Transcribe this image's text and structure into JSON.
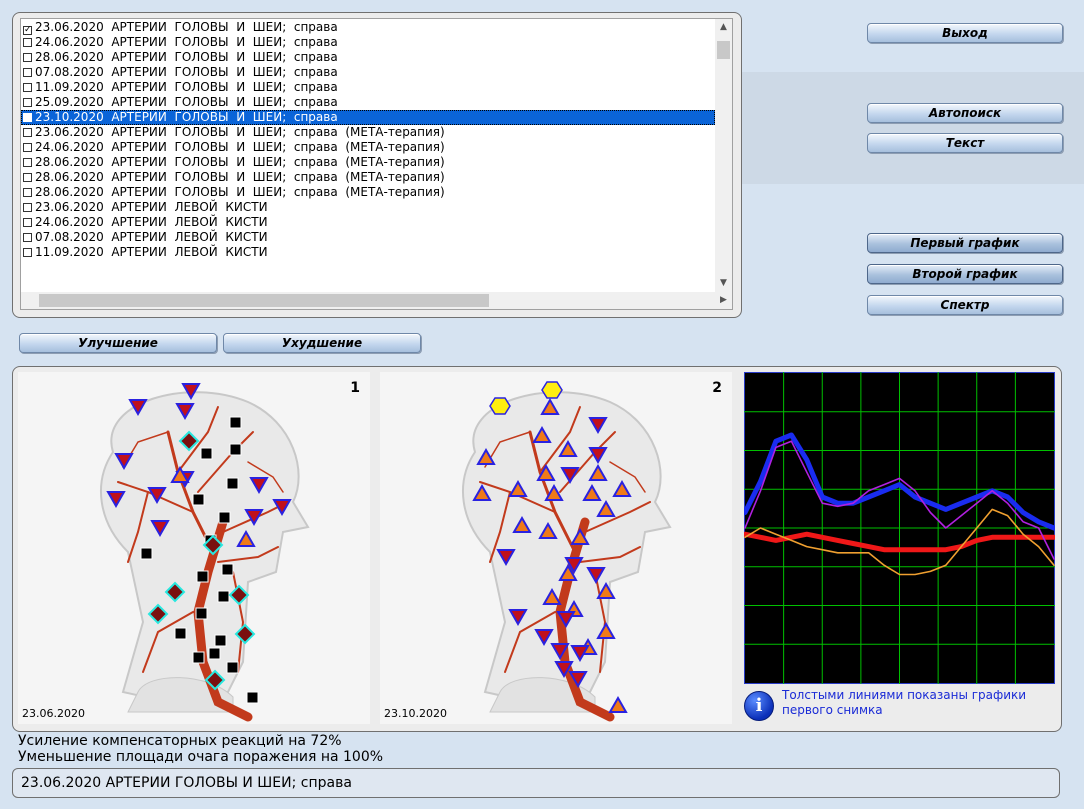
{
  "records": [
    {
      "text": "23.06.2020  АРТЕРИИ  ГОЛОВЫ  И  ШЕИ;  справа",
      "checked": true,
      "selected": false
    },
    {
      "text": "24.06.2020  АРТЕРИИ  ГОЛОВЫ  И  ШЕИ;  справа",
      "checked": false,
      "selected": false
    },
    {
      "text": "28.06.2020  АРТЕРИИ  ГОЛОВЫ  И  ШЕИ;  справа",
      "checked": false,
      "selected": false
    },
    {
      "text": "07.08.2020  АРТЕРИИ  ГОЛОВЫ  И  ШЕИ;  справа",
      "checked": false,
      "selected": false
    },
    {
      "text": "11.09.2020  АРТЕРИИ  ГОЛОВЫ  И  ШЕИ;  справа",
      "checked": false,
      "selected": false
    },
    {
      "text": "25.09.2020  АРТЕРИИ  ГОЛОВЫ  И  ШЕИ;  справа",
      "checked": false,
      "selected": false
    },
    {
      "text": "23.10.2020  АРТЕРИИ  ГОЛОВЫ  И  ШЕИ;  справа",
      "checked": false,
      "selected": true
    },
    {
      "text": "23.06.2020  АРТЕРИИ  ГОЛОВЫ  И  ШЕИ;  справа  (МЕТА-терапия)",
      "checked": false,
      "selected": false
    },
    {
      "text": "24.06.2020  АРТЕРИИ  ГОЛОВЫ  И  ШЕИ;  справа  (МЕТА-терапия)",
      "checked": false,
      "selected": false
    },
    {
      "text": "28.06.2020  АРТЕРИИ  ГОЛОВЫ  И  ШЕИ;  справа  (МЕТА-терапия)",
      "checked": false,
      "selected": false
    },
    {
      "text": "28.06.2020  АРТЕРИИ  ГОЛОВЫ  И  ШЕИ;  справа  (МЕТА-терапия)",
      "checked": false,
      "selected": false
    },
    {
      "text": "28.06.2020  АРТЕРИИ  ГОЛОВЫ  И  ШЕИ;  справа  (МЕТА-терапия)",
      "checked": false,
      "selected": false
    },
    {
      "text": "23.06.2020  АРТЕРИИ  ЛЕВОЙ  КИСТИ",
      "checked": false,
      "selected": false
    },
    {
      "text": "24.06.2020  АРТЕРИИ  ЛЕВОЙ  КИСТИ",
      "checked": false,
      "selected": false
    },
    {
      "text": "07.08.2020  АРТЕРИИ  ЛЕВОЙ  КИСТИ",
      "checked": false,
      "selected": false
    },
    {
      "text": "11.09.2020  АРТЕРИИ  ЛЕВОЙ  КИСТИ",
      "checked": false,
      "selected": false
    }
  ],
  "buttons": {
    "exit": "Выход",
    "autosearch": "Автопоиск",
    "text": "Текст",
    "first_graph": "Первый график",
    "second_graph": "Второй график",
    "spectrum": "Спектр",
    "improvement": "Улучшение",
    "deterioration": "Ухудшение"
  },
  "images": [
    {
      "number": "1",
      "date": "23.06.2020"
    },
    {
      "number": "2",
      "date": "23.10.2020"
    }
  ],
  "info_text": "Толстыми линиями показаны графики первого снимка",
  "stats": [
    "Усиление компенсаторных реакций на 72%",
    "Уменьшение площади очага поражения на 100%"
  ],
  "selected_record": "23.06.2020 АРТЕРИИ  ГОЛОВЫ  И  ШЕИ;  справа",
  "colors": {
    "thick_blue": "#1a2cf0",
    "thick_red": "#f01818",
    "thin_violet": "#b020e0",
    "thin_orange": "#f0a030",
    "grid": "#00c000",
    "chart_bg": "#000000"
  },
  "chart_data": {
    "type": "line",
    "x": [
      0,
      1,
      2,
      3,
      4,
      5,
      6,
      7,
      8,
      9,
      10,
      11,
      12,
      13,
      14,
      15,
      16,
      17,
      18,
      19,
      20
    ],
    "series": [
      {
        "style": "thick",
        "color": "#1a2cf0",
        "values": [
          55,
          65,
          78,
          80,
          72,
          60,
          58,
          58,
          60,
          62,
          64,
          60,
          58,
          56,
          58,
          60,
          62,
          60,
          55,
          52,
          50
        ]
      },
      {
        "style": "thick",
        "color": "#f01818",
        "values": [
          48,
          47,
          46,
          47,
          48,
          47,
          46,
          45,
          44,
          43,
          43,
          43,
          43,
          43,
          44,
          46,
          47,
          47,
          47,
          47,
          47
        ]
      },
      {
        "style": "thin",
        "color": "#b020e0",
        "values": [
          50,
          62,
          76,
          78,
          68,
          58,
          57,
          58,
          62,
          64,
          66,
          62,
          55,
          50,
          54,
          58,
          62,
          58,
          52,
          50,
          40
        ]
      },
      {
        "style": "thin",
        "color": "#f0a030",
        "values": [
          47,
          50,
          48,
          46,
          44,
          43,
          42,
          42,
          42,
          38,
          35,
          35,
          36,
          38,
          44,
          50,
          56,
          54,
          48,
          44,
          38
        ]
      }
    ],
    "ylim": [
      0,
      100
    ],
    "xlim": [
      0,
      20
    ],
    "grid": true
  }
}
